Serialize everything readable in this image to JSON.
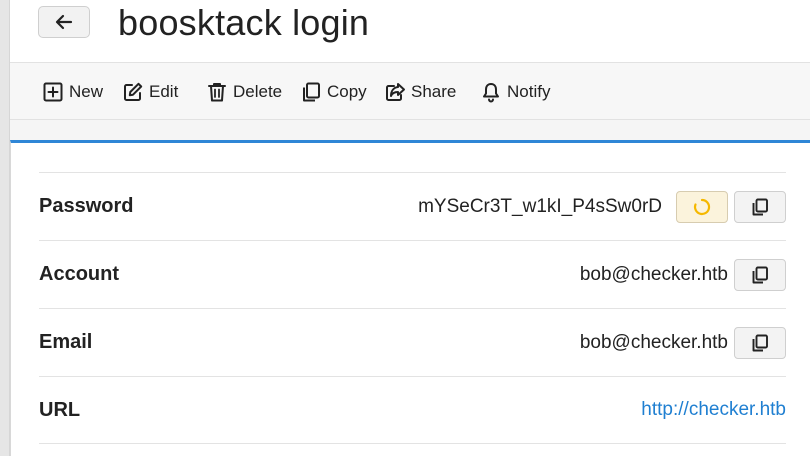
{
  "header": {
    "title": "boosktack login",
    "back_icon": "arrow-left-icon"
  },
  "toolbar": {
    "items": [
      {
        "label": "New",
        "icon": "plus-square-icon"
      },
      {
        "label": "Edit",
        "icon": "edit-icon"
      },
      {
        "label": "Delete",
        "icon": "trash-icon"
      },
      {
        "label": "Copy",
        "icon": "copy-icon"
      },
      {
        "label": "Share",
        "icon": "share-icon"
      },
      {
        "label": "Notify",
        "icon": "bell-icon"
      }
    ]
  },
  "fields": [
    {
      "label": "Password",
      "value": "mYSeCr3T_w1kI_P4sSw0rD"
    },
    {
      "label": "Account",
      "value": "bob@checker.htb"
    },
    {
      "label": "Email",
      "value": "bob@checker.htb"
    },
    {
      "label": "URL",
      "value": "http://checker.htb"
    }
  ],
  "colors": {
    "accent": "#2f86d6",
    "link": "#1f7fd1",
    "spinner": "#f5b800"
  }
}
